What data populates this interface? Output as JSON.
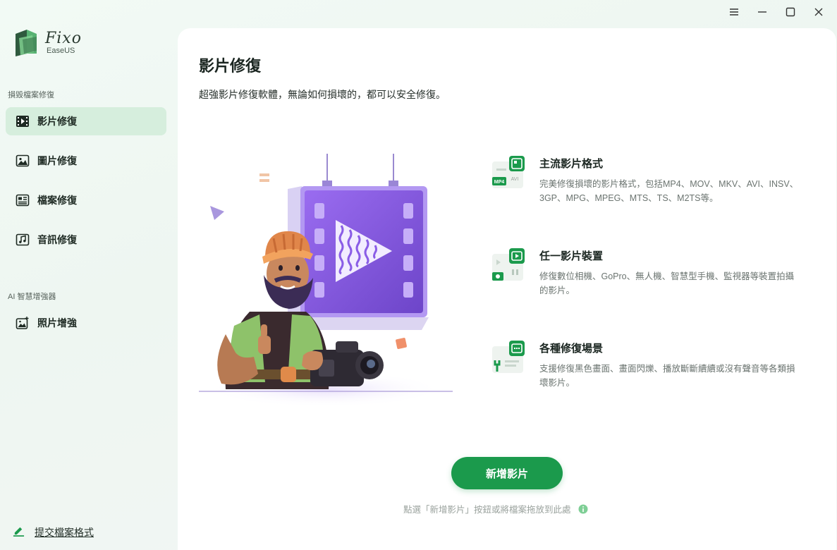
{
  "window": {
    "controls": [
      "menu-icon",
      "minimize-icon",
      "maximize-icon",
      "close-icon"
    ]
  },
  "brand": {
    "name": "Fixo",
    "sub": "EaseUS"
  },
  "sidebar": {
    "section_repair": "損毀檔案修復",
    "section_ai": "AI 智慧增強器",
    "items": [
      {
        "label": "影片修復",
        "icon": "video-icon",
        "active": true
      },
      {
        "label": "圖片修復",
        "icon": "image-icon",
        "active": false
      },
      {
        "label": "檔案修復",
        "icon": "document-icon",
        "active": false
      },
      {
        "label": "音訊修復",
        "icon": "music-icon",
        "active": false
      },
      {
        "label": "照片增強",
        "icon": "photo-enhance-icon",
        "active": false
      }
    ],
    "submit_label": "提交檔案格式"
  },
  "main": {
    "title": "影片修復",
    "description": "超強影片修復軟體，無論如何損壞的，都可以安全修復。",
    "features": [
      {
        "title": "主流影片格式",
        "desc": "完美修復損壞的影片格式，包括MP4、MOV、MKV、AVI、INSV、3GP、MPG、MPEG、MTS、TS、M2TS等。",
        "icon": "video-format-icon",
        "badge_mp4": "MP4",
        "badge_avi": "AVI"
      },
      {
        "title": "任一影片裝置",
        "desc": "修復數位相機、GoPro、無人機、智慧型手機、監視器等裝置拍攝的影片。",
        "icon": "video-device-icon"
      },
      {
        "title": "各種修復場景",
        "desc": "支援修復黑色畫面、畫面閃爍、播放斷斷續續或沒有聲音等各類損壞影片。",
        "icon": "repair-scenario-icon"
      }
    ],
    "add_button": "新增影片",
    "hint": "點選「新增影片」按鈕或將檔案拖放到此處"
  },
  "colors": {
    "accent": "#1b9a4c",
    "active_nav_bg": "#d6eedd",
    "illustration_screen": "#8c5ce6"
  }
}
